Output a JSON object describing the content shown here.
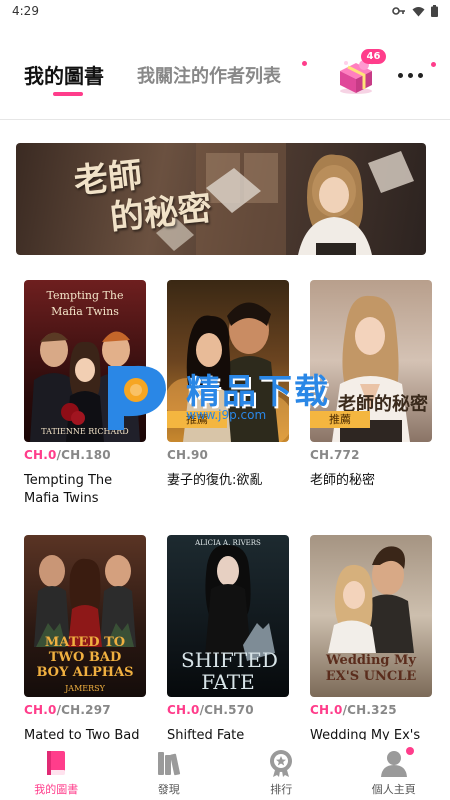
{
  "status_bar": {
    "time": "4:29"
  },
  "header": {
    "tabs": [
      {
        "label": "我的圖書",
        "active": true
      },
      {
        "label": "我關注的作者列表",
        "active": false
      }
    ],
    "gift_badge": "46"
  },
  "banner": {
    "title_line1": "老師",
    "title_line2": "的秘密"
  },
  "books": [
    {
      "cover_title": "Tempting The Mafia Twins",
      "cover_author": "TATIENNE RICHARD",
      "current_chapter": "CH.0",
      "total_chapters": "/CH.180",
      "title": "Tempting The Mafia Twins",
      "cover_color": "#3a1414"
    },
    {
      "cover_title": "",
      "cover_author": "",
      "current_chapter": "CH.90",
      "total_chapters": "",
      "title": "妻子的復仇:欲亂",
      "cover_color": "#5a3a1f",
      "tag": "推薦"
    },
    {
      "cover_title": "老師的秘密",
      "cover_author": "",
      "current_chapter": "CH.772",
      "total_chapters": "",
      "title": "老師的秘密",
      "cover_color": "#cdb9aa",
      "tag": "推薦"
    },
    {
      "cover_title": "MATED TO TWO BAD BOY ALPHAS",
      "cover_author": "JAMERSY",
      "current_chapter": "CH.0",
      "total_chapters": "/CH.297",
      "title": "Mated to Two Bad",
      "cover_color": "#2b1a14"
    },
    {
      "cover_title": "SHIFTED FATE",
      "cover_author": "ALICIA A. RIVERS",
      "current_chapter": "CH.0",
      "total_chapters": "/CH.570",
      "title": "Shifted Fate",
      "cover_color": "#142228"
    },
    {
      "cover_title": "Wedding My EX'S UNCLE",
      "cover_author": "",
      "current_chapter": "CH.0",
      "total_chapters": "/CH.325",
      "title": "Wedding My Ex's",
      "cover_color": "#8f7d6a"
    }
  ],
  "watermark": {
    "text": "精品下载",
    "url": "www.j9p.com"
  },
  "bottom_nav": [
    {
      "label": "我的圖書",
      "icon": "book-icon",
      "active": true
    },
    {
      "label": "發現",
      "icon": "bookshelf-icon",
      "active": false
    },
    {
      "label": "排行",
      "icon": "medal-icon",
      "active": false
    },
    {
      "label": "個人主頁",
      "icon": "person-icon",
      "active": false
    }
  ],
  "colors": {
    "accent": "#ff3d8b",
    "tag": "#f4b640",
    "watermark": "#2a87e6"
  }
}
